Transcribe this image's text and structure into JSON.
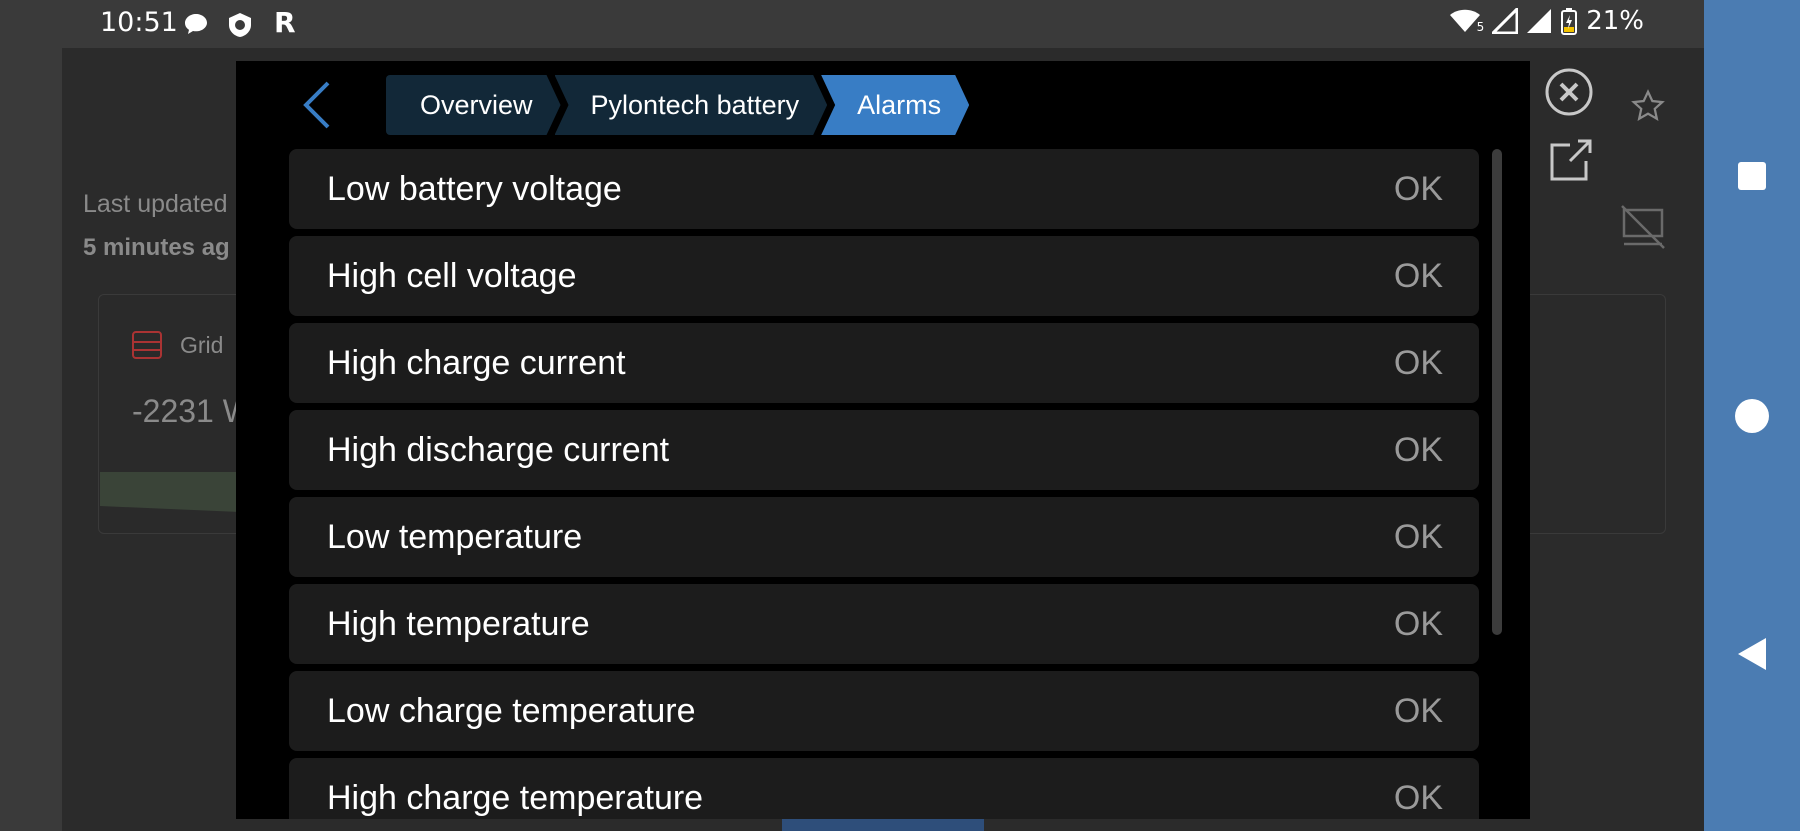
{
  "status_bar": {
    "time": "10:51",
    "battery_percent": "21%",
    "wifi_badge": "5",
    "icons": [
      "chat-bubble-icon",
      "shield-app-icon",
      "r-app-icon",
      "wifi-icon",
      "signal-icon",
      "signal-icon",
      "battery-charging-icon"
    ]
  },
  "background": {
    "last_updated_label": "Last updated",
    "last_updated_value": "5 minutes ag",
    "grid_label": "Grid",
    "grid_value": "-2231 W"
  },
  "modal": {
    "breadcrumbs": [
      {
        "label": "Overview",
        "active": false
      },
      {
        "label": "Pylontech battery",
        "active": false
      },
      {
        "label": "Alarms",
        "active": true
      }
    ],
    "alarms": [
      {
        "label": "Low battery voltage",
        "value": "OK"
      },
      {
        "label": "High cell voltage",
        "value": "OK"
      },
      {
        "label": "High charge current",
        "value": "OK"
      },
      {
        "label": "High discharge current",
        "value": "OK"
      },
      {
        "label": "Low temperature",
        "value": "OK"
      },
      {
        "label": "High temperature",
        "value": "OK"
      },
      {
        "label": "Low charge temperature",
        "value": "OK"
      },
      {
        "label": "High charge temperature",
        "value": "OK"
      }
    ]
  },
  "colors": {
    "accent": "#387dc5",
    "crumb_bg": "#122838",
    "row_bg": "#1c1c1c",
    "nav_bar": "#4b7cb2"
  }
}
